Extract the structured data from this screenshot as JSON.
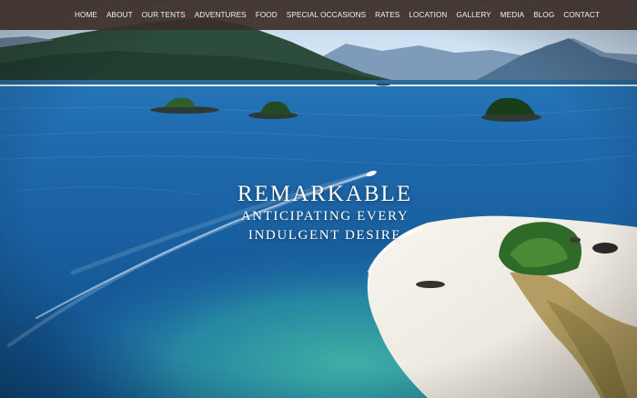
{
  "nav": {
    "items": [
      "HOME",
      "ABOUT",
      "OUR TENTS",
      "ADVENTURES",
      "FOOD",
      "SPECIAL OCCASIONS",
      "RATES",
      "LOCATION",
      "GALLERY",
      "MEDIA",
      "BLOG",
      "CONTACT"
    ]
  },
  "hero": {
    "title": "REMARKABLE",
    "subtitle_line1": "ANTICIPATING EVERY",
    "subtitle_line2": "INDULGENT DESIRE"
  },
  "colors": {
    "navbar": "#3c2e28",
    "sea": "#1b5f98",
    "sky": "#d9e9f5"
  }
}
